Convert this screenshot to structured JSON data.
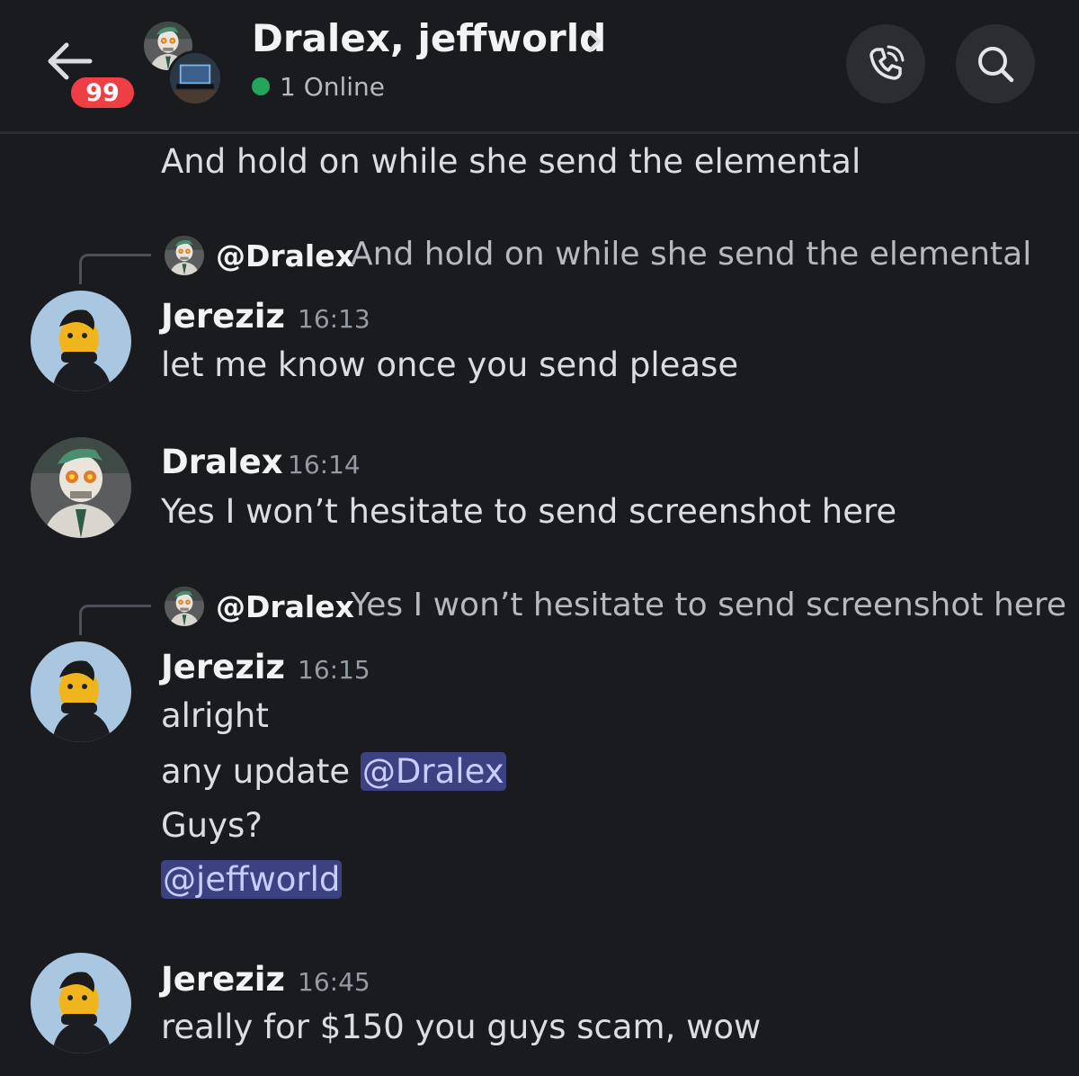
{
  "header": {
    "title": "Dralex, jeffworld",
    "status": "1 Online",
    "unread_badge": "99",
    "icons": [
      "back-arrow-icon",
      "chevron-right-icon",
      "call-icon",
      "search-icon"
    ],
    "status_color": "#23a55a",
    "badge_color": "#ef3f45"
  },
  "messages": {
    "m0_text": "And hold on while she send the elemental",
    "m1": {
      "reply_name": "@Dralex",
      "reply_text": "And hold on while she send the elemental",
      "author": "Jereziz",
      "time": "16:13",
      "text": "let me know once you send please"
    },
    "m2": {
      "author": "Dralex",
      "time": "16:14",
      "text": "Yes I won’t hesitate to send screenshot here"
    },
    "m3": {
      "reply_name": "@Dralex",
      "reply_text": "Yes I won’t hesitate to send screenshot here",
      "author": "Jereziz",
      "time": "16:15",
      "line1": "alright",
      "line2_prefix": "any update ",
      "line2_mention": "@Dralex",
      "line3": "Guys?",
      "line4_mention": "@jeffworld"
    },
    "m4": {
      "author": "Jereziz",
      "time": "16:45",
      "text": "really for $150 you guys scam, wow"
    }
  },
  "colors": {
    "background": "#1a1b1f",
    "mention_bg": "#3c4281",
    "mention_text": "#c9cdfb"
  }
}
